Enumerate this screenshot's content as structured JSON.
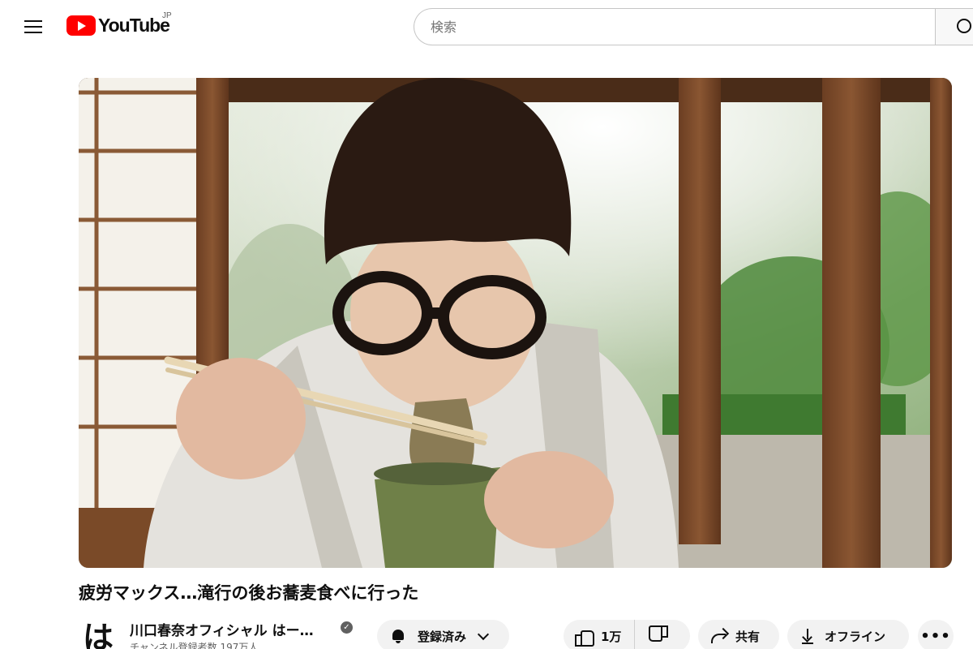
{
  "header": {
    "logo_text": "YouTube",
    "region": "JP",
    "search_placeholder": "検索"
  },
  "video": {
    "title": "疲労マックス…滝行の後お蕎麦食べに行った"
  },
  "channel": {
    "avatar_text": "は",
    "name": "川口春奈オフィシャル はー…",
    "subscribers": "チャンネル登録者数 197万人"
  },
  "actions": {
    "subscribe_label": "登録済み",
    "like_count": "1万",
    "share_label": "共有",
    "offline_label": "オフライン",
    "more_label": "•••"
  },
  "colors": {
    "brand_red": "#ff0000",
    "pill_bg": "#f2f2f2",
    "text_primary": "#0f0f0f",
    "text_secondary": "#606060"
  },
  "icons": [
    "menu-icon",
    "youtube-logo-icon",
    "search-icon",
    "bell-icon",
    "chevron-down-icon",
    "thumbs-up-icon",
    "thumbs-down-icon",
    "share-icon",
    "download-icon",
    "more-icon",
    "verified-icon"
  ]
}
